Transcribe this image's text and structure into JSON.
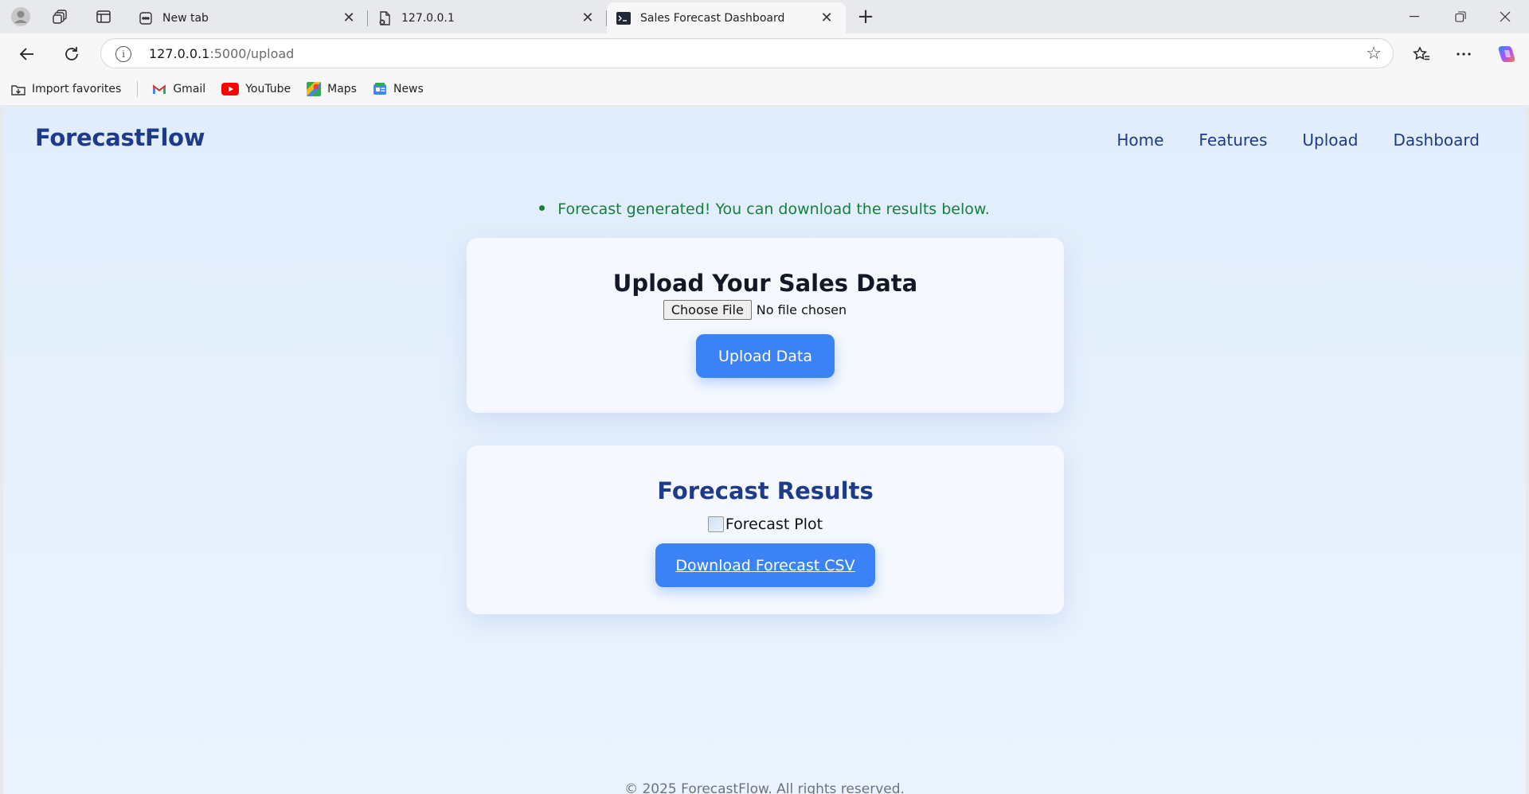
{
  "browser": {
    "tabs": [
      {
        "title": "New tab",
        "favicon": "newtab-icon"
      },
      {
        "title": "127.0.0.1",
        "favicon": "file-icon"
      },
      {
        "title": "Sales Forecast Dashboard",
        "favicon": "terminal-icon"
      }
    ],
    "address": {
      "host": "127.0.0.1",
      "path": ":5000/upload"
    },
    "bookmarks": [
      {
        "label": "Import favorites",
        "icon": "import-icon"
      },
      {
        "label": "Gmail",
        "icon": "gmail-icon"
      },
      {
        "label": "YouTube",
        "icon": "youtube-icon"
      },
      {
        "label": "Maps",
        "icon": "maps-icon"
      },
      {
        "label": "News",
        "icon": "news-icon"
      }
    ]
  },
  "site": {
    "brand": "ForecastFlow",
    "nav": [
      "Home",
      "Features",
      "Upload",
      "Dashboard"
    ],
    "flash": "Forecast generated! You can download the results below.",
    "upload": {
      "title": "Upload Your Sales Data",
      "choose_label": "Choose File",
      "file_status": "No file chosen",
      "button": "Upload Data"
    },
    "results": {
      "title": "Forecast Results",
      "plot_alt": "Forecast Plot",
      "download": "Download Forecast CSV"
    },
    "footer": "© 2025 ForecastFlow. All rights reserved."
  },
  "colors": {
    "brand": "#1e3a8a",
    "accent": "#3b82f6",
    "success": "#15803d"
  }
}
